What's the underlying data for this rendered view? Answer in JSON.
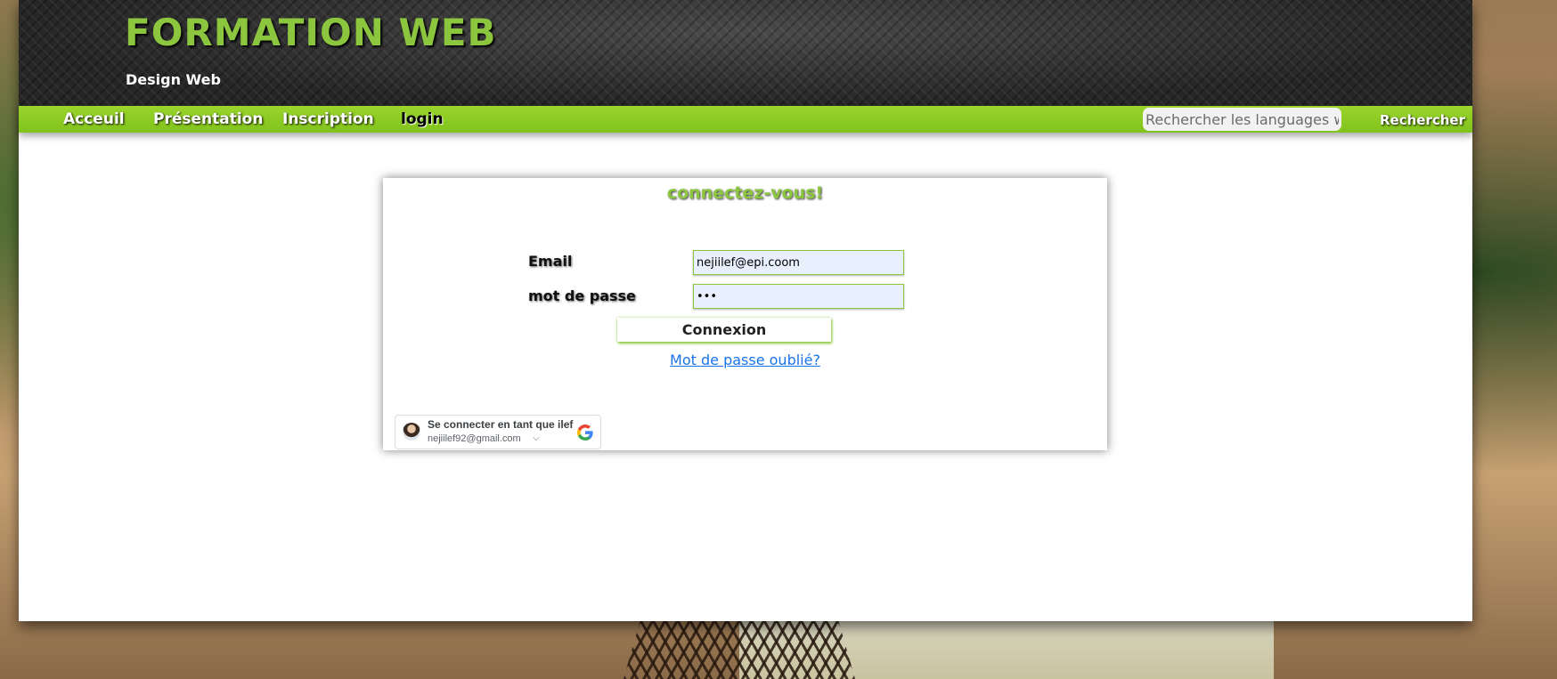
{
  "header": {
    "title": "FORMATION WEB",
    "subtitle": "Design Web"
  },
  "nav": {
    "items": [
      "Acceuil",
      "Présentation",
      "Inscription",
      "login"
    ],
    "active": "login"
  },
  "search": {
    "placeholder": "Rechercher les languages web",
    "button_label": "Rechercher"
  },
  "login": {
    "title": "connectez-vous!",
    "email_label": "Email",
    "email_value": "nejiilef@epi.coom",
    "password_label": "mot de passe",
    "password_value": "•••",
    "submit_label": "Connexion",
    "forgot_label": "Mot de passe oublié?"
  },
  "google": {
    "prompt": "Se connecter en tant que ilef",
    "email": "nejiilef92@gmail.com"
  },
  "colors": {
    "accent": "#8cc63f",
    "link": "#1a73e8"
  }
}
